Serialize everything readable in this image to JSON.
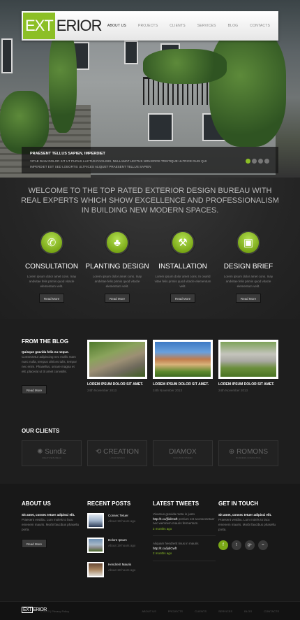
{
  "header": {
    "logo_box": "EXT",
    "logo_rest": "ERIOR",
    "nav": [
      "ABOUT US",
      "PROJECTS",
      "CLIENTS",
      "SERVICES",
      "BLOG",
      "CONTACTS"
    ],
    "active_nav": "ABOUT US"
  },
  "slider": {
    "title": "PRAESENT TELLUS SAPIEN, IMPERDIET",
    "text": "VITAE DIAM DOLOR SIT UT PURUS LUCTUS FACILISIS. NULLAMAT LECTUS NON EROS TRISTIQUE ULTRICE DUIS QUI IMPERDIET EST SED LOBORTIS ULTRICES ALIQUET PRAESENT TELLUS SAPIEN",
    "active_slide": 1,
    "slides": 4
  },
  "welcome": {
    "heading": "WELCOME TO THE TOP RATED EXTERIOR DESIGN BUREAU WITH REAL EXPERTS WHICH SHOW EXCELLENCE AND PROFESSIONALISM IN BUILDING NEW MODERN SPACES.",
    "features": [
      {
        "icon": "phone-icon",
        "glyph": "✆",
        "title": "CONSULTATION",
        "text": "Lorem ipsum dolor amet cons. Inay andvitae felis primis quod vitacle elementum velit.",
        "button": "Read More"
      },
      {
        "icon": "tree-icon",
        "glyph": "♣",
        "title": "PLANTING DESIGN",
        "text": "Lorem ipsum dolor amet cons. Inay andvitae felis primis quod vitacle elementum velit.",
        "button": "Read More"
      },
      {
        "icon": "tools-icon",
        "glyph": "⚒",
        "title": "INSTALLATION",
        "text": "Lorem ipsum dolor amet cons. In ovarid vitae felis primis quod vitacle elementum velit.",
        "button": "Read More"
      },
      {
        "icon": "picture-icon",
        "glyph": "▣",
        "title": "DESIGN BRIEF",
        "text": "Lorem ipsum dolor amet cons. Inay andvitae felis primis quod vitacle elementum velit.",
        "button": "Read More"
      }
    ]
  },
  "blog": {
    "title": "FROM THE BLOG",
    "intro_bold": "Quisque gravida felis eu neque.",
    "intro_text": "Consectetur adipiscing nec mollit. Nam nunc nulla, tempus ultrices tulis, tempor nec enim. Phasellus, ornare magna et elit. placerat ut tit amet convallis.",
    "button": "Read More",
    "posts": [
      {
        "title": "LOREM IPSUM DOLOR SIT AMET.",
        "date": "24th November 2013"
      },
      {
        "title": "LOREM IPSUM DOLOR SIT AMET.",
        "date": "24th November 2013"
      },
      {
        "title": "LOREM IPSUM DOLOR SIT AMET.",
        "date": "24th November 2013"
      }
    ]
  },
  "clients": {
    "title": "OUR CLIENTS",
    "logos": [
      {
        "name": "Sundiz",
        "sub": "CREATIVE BUREAU",
        "glyph": "✺"
      },
      {
        "name": "CREATION",
        "sub": "LOGO DESIGN",
        "glyph": "⟲"
      },
      {
        "name": "DIAMOX",
        "sub": "SOLUTION STUDIO",
        "glyph": ""
      },
      {
        "name": "ROMONS",
        "sub": "BUSINESS CONSULTING",
        "glyph": "⊕"
      }
    ]
  },
  "footer": {
    "about": {
      "title": "ABOUT US",
      "bold": "Sit amet, consec tetuer adipisci elit.",
      "text": "Praesent vestibu. Lum molels to lacu emenem mauris. Morbi faucibus phasellu porta.",
      "button": "Read More"
    },
    "recent": {
      "title": "RECENT POSTS",
      "items": [
        {
          "title": "Consec Tetuer",
          "meta": "About 19 hours ago"
        },
        {
          "title": "Dolore Ipsum",
          "meta": "About 19 hours ago"
        },
        {
          "title": "Hendrerit Mauris",
          "meta": "About 19 hours ago"
        }
      ]
    },
    "tweets": {
      "title": "LATEST TWEETS",
      "items": [
        {
          "text": "Vivamus gravida meta in justo",
          "link": "http://t.co/jfidiCwft",
          "text2": "pretium est aconsectetuer nec wemnem mauris fermentum.",
          "meta": "2 months ago"
        },
        {
          "text": "Aliquam hendrerit risus in mauris",
          "link": "http://t.co/jidiCwft",
          "text2": "",
          "meta": "2 months ago"
        }
      ]
    },
    "contact": {
      "title": "GET IN TOUCH",
      "bold": "Sit amet, consec tetuer adipisci elit.",
      "text": "Praesent vestibu. Lum molels to lacu emenem mauris. Morbi faucibus phasellu porta.",
      "social": [
        {
          "icon": "facebook-icon",
          "glyph": "f"
        },
        {
          "icon": "twitter-icon",
          "glyph": "t"
        },
        {
          "icon": "google-plus-icon",
          "glyph": "g+"
        },
        {
          "icon": "rss-icon",
          "glyph": "≈"
        }
      ]
    }
  },
  "bottom": {
    "logo_box": "EXT",
    "logo_rest": "ERIOR",
    "copyright": "© 2013 | Privacy Policy",
    "nav": [
      "ABOUT US",
      "PROJECTS",
      "CLIENTS",
      "SERVICES",
      "BLOG",
      "CONTACTS"
    ]
  },
  "colors": {
    "accent": "#8cbf26",
    "background": "#1c1c1c",
    "footer": "#181818"
  }
}
